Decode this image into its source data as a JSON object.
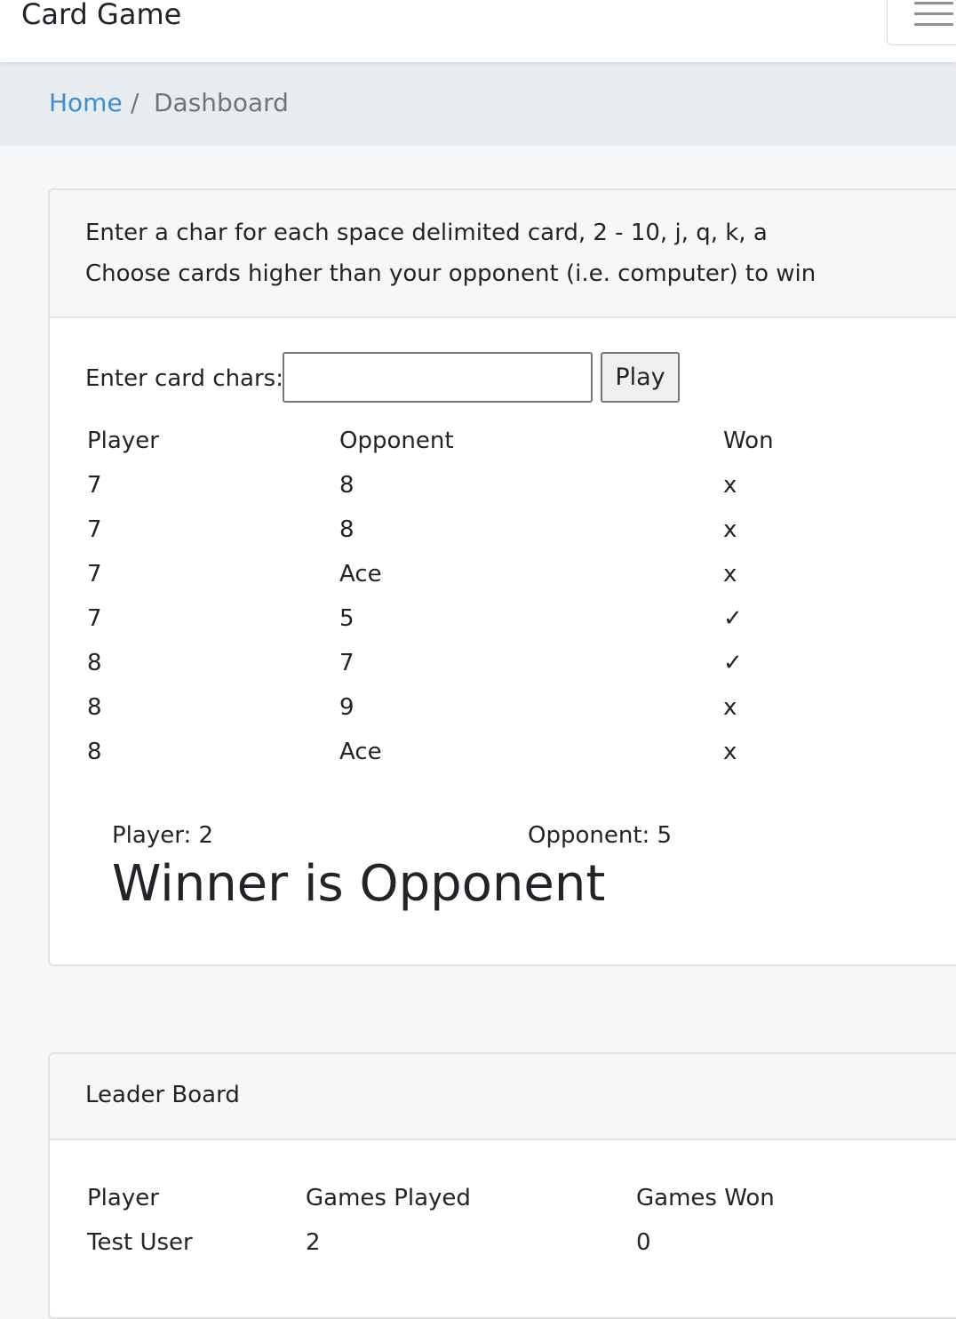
{
  "navbar": {
    "brand": "Card Game",
    "menu_icon": "hamburger-menu-icon"
  },
  "breadcrumb": {
    "home": "Home",
    "separator": "/",
    "current": "Dashboard"
  },
  "game": {
    "instructions": [
      "Enter a char for each space delimited card, 2 - 10, j, q, k, a",
      "Choose cards higher than your opponent (i.e. computer) to win"
    ],
    "input_label": "Enter card chars:",
    "input_value": "",
    "play_label": "Play",
    "columns": [
      "Player",
      "Opponent",
      "Won"
    ],
    "rows": [
      {
        "player": "7",
        "opponent": "8",
        "won": "x"
      },
      {
        "player": "7",
        "opponent": "8",
        "won": "x"
      },
      {
        "player": "7",
        "opponent": "Ace",
        "won": "x"
      },
      {
        "player": "7",
        "opponent": "5",
        "won": "✓"
      },
      {
        "player": "8",
        "opponent": "7",
        "won": "✓"
      },
      {
        "player": "8",
        "opponent": "9",
        "won": "x"
      },
      {
        "player": "8",
        "opponent": "Ace",
        "won": "x"
      }
    ],
    "player_score": "Player: 2",
    "opponent_score": "Opponent: 5",
    "winner": "Winner is Opponent"
  },
  "leaderboard": {
    "title": "Leader Board",
    "columns": [
      "Player",
      "Games Played",
      "Games Won"
    ],
    "rows": [
      {
        "player": "Test User",
        "played": "2",
        "won": "0"
      }
    ]
  },
  "colors": {
    "link": "#3a8fd6",
    "muted": "#6c757d",
    "breadcrumb_bg": "#e9ecef",
    "page_bg": "#f6f7f9"
  }
}
